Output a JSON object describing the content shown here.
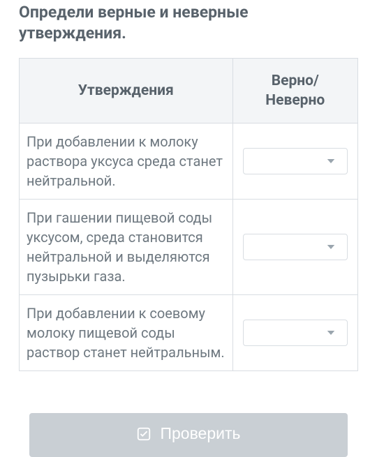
{
  "heading": "Определи верные и неверные утверждения.",
  "table": {
    "headers": {
      "statement": "Утверждения",
      "truefalse_line1": "Верно/",
      "truefalse_line2": "Неверно"
    },
    "rows": [
      {
        "text": "При добавлении к молоку раствора уксуса среда станет нейтральной."
      },
      {
        "text": "При гашении пищевой соды уксусом, среда становится нейтральной и выделяются пузырьки газа."
      },
      {
        "text": "При добавлении к соевому молоку пищевой соды раствор станет нейтральным."
      }
    ]
  },
  "button": {
    "label": "Проверить"
  }
}
